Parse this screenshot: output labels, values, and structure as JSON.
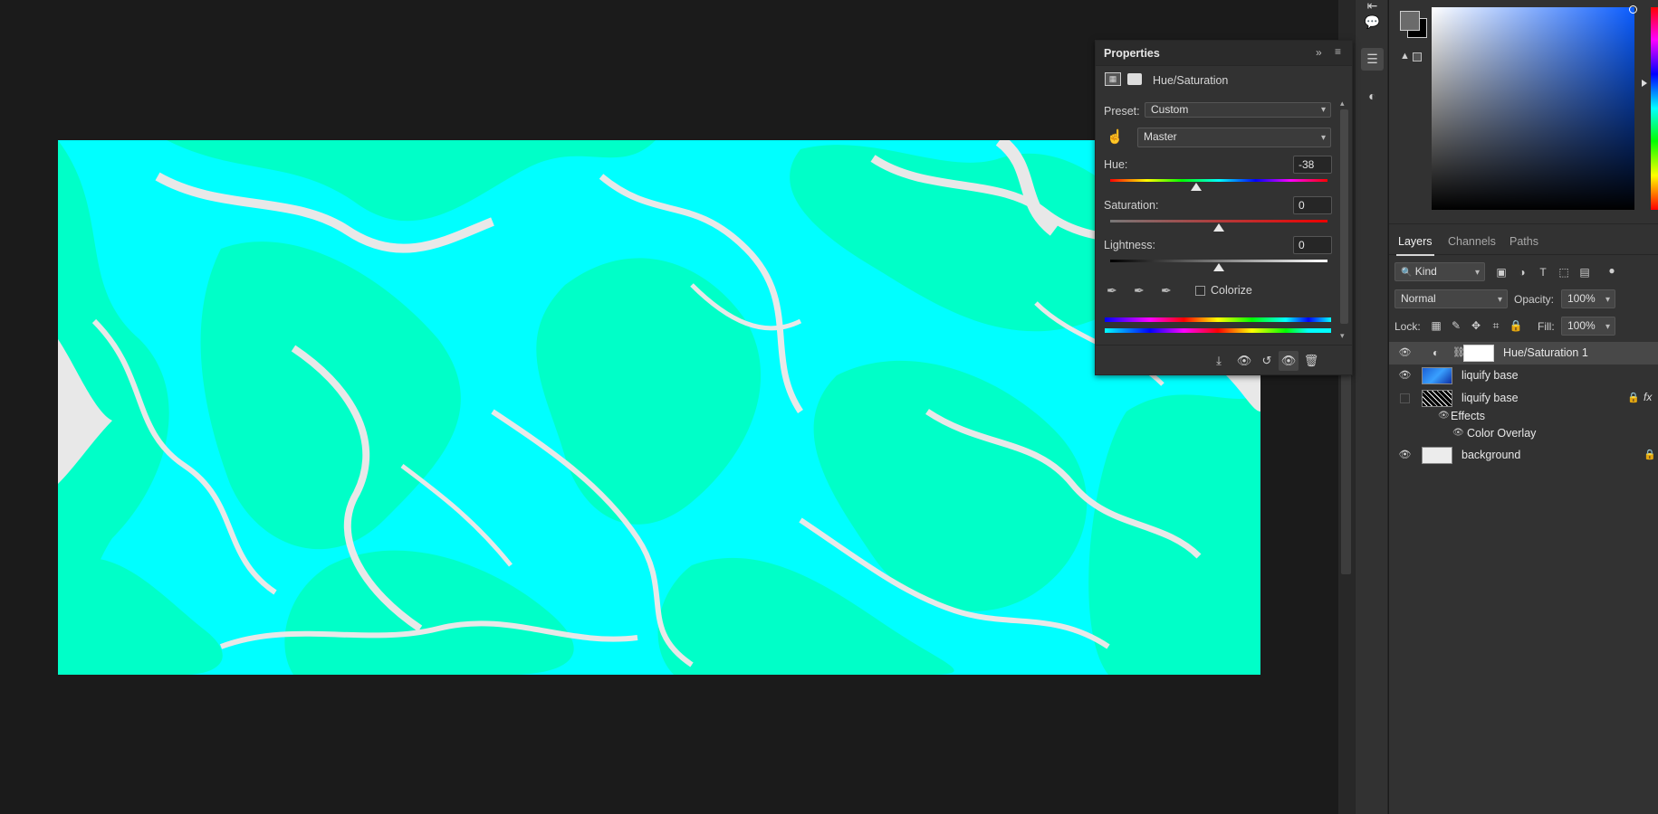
{
  "properties": {
    "title": "Properties",
    "adjustment_name": "Hue/Saturation",
    "preset_label": "Preset:",
    "preset_value": "Custom",
    "channel_value": "Master",
    "hue_label": "Hue:",
    "hue_value": "-38",
    "hue_fraction": 0.394,
    "saturation_label": "Saturation:",
    "saturation_value": "0",
    "saturation_fraction": 0.5,
    "lightness_label": "Lightness:",
    "lightness_value": "0",
    "lightness_fraction": 0.5,
    "colorize_label": "Colorize",
    "colorize_checked": false
  },
  "color_picker": {
    "foreground": "#6b6b6b",
    "background": "#000000",
    "hue_color": "#0a5cff"
  },
  "layers": {
    "tabs": [
      "Layers",
      "Channels",
      "Paths"
    ],
    "active_tab": "Layers",
    "filter_kind": "Kind",
    "blend_mode": "Normal",
    "opacity_label": "Opacity:",
    "opacity_value": "100%",
    "lock_label": "Lock:",
    "fill_label": "Fill:",
    "fill_value": "100%",
    "items": [
      {
        "name": "Hue/Saturation 1",
        "visible": true,
        "selected": true
      },
      {
        "name": "liquify base",
        "visible": true,
        "selected": false
      },
      {
        "name": "liquify base",
        "visible": false,
        "selected": false,
        "locked": true,
        "fx": "fx"
      },
      {
        "name": "Effects"
      },
      {
        "name": "Color Overlay"
      },
      {
        "name": "background",
        "visible": true,
        "selected": false,
        "locked": true
      }
    ]
  },
  "canvas": {
    "base_color": "#00ffff",
    "swirl_color": "#00ffc8",
    "highlight_color": "#e8e8e8"
  }
}
